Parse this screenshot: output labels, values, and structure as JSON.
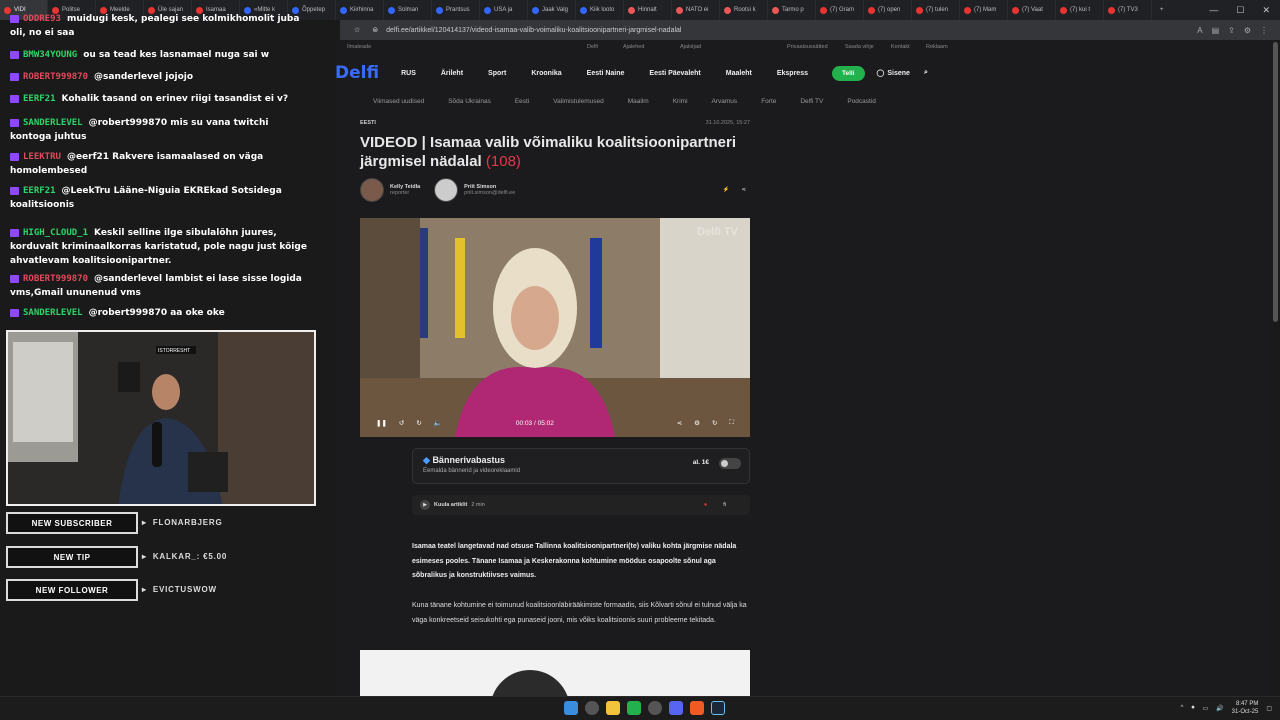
{
  "browser": {
    "tabs": [
      {
        "label": "VIDI",
        "color": "#e33"
      },
      {
        "label": "Politse",
        "color": "#e33"
      },
      {
        "label": "Meelde",
        "color": "#e33"
      },
      {
        "label": "Üle sajan",
        "color": "#e33"
      },
      {
        "label": "Isamaa",
        "color": "#e33"
      },
      {
        "label": "«Mitte k",
        "color": "#36f"
      },
      {
        "label": "Õppetep",
        "color": "#36f"
      },
      {
        "label": "Kiirhinna",
        "color": "#36f"
      },
      {
        "label": "Solman",
        "color": "#36f"
      },
      {
        "label": "Prantsus",
        "color": "#36f"
      },
      {
        "label": "USA ja",
        "color": "#36f"
      },
      {
        "label": "Jaak Valg",
        "color": "#36f"
      },
      {
        "label": "Kiik looto",
        "color": "#36f"
      },
      {
        "label": "Hinnalt",
        "color": "#e55"
      },
      {
        "label": "NATO ei",
        "color": "#e55"
      },
      {
        "label": "Rootsi k",
        "color": "#e55"
      },
      {
        "label": "Tarmo p",
        "color": "#e55"
      },
      {
        "label": "(7) Gram",
        "color": "#e33"
      },
      {
        "label": "(7) open",
        "color": "#e33"
      },
      {
        "label": "(7) tulen",
        "color": "#e33"
      },
      {
        "label": "(7) Mam",
        "color": "#e33"
      },
      {
        "label": "(7) Vaat",
        "color": "#e33"
      },
      {
        "label": "(7) kui t",
        "color": "#e33"
      },
      {
        "label": "(7) TV3",
        "color": "#e33"
      }
    ],
    "url": "delfi.ee/artikkel/120414137/videod-isamaa-valib-voimaliku-koalitsioonipartneri-jargmisel-nadalal",
    "win_controls": [
      "—",
      "☐",
      "✕"
    ]
  },
  "chat": {
    "messages": [
      {
        "name": "ODDRE93",
        "text": "muidugi kesk, pealegi see kolmikhomolit juba oli, no ei saa",
        "color": "red"
      },
      {
        "name": "BMW34YOUNG",
        "text": "ou sa tead kes lasnamael nuga sai w",
        "color": "grn"
      },
      {
        "name": "ROBERT999870",
        "text": "@sanderlevel jojojo",
        "color": "red"
      },
      {
        "name": "EERF21",
        "text": "Kohalik tasand on erinev riigi tasandist ei v?",
        "color": "grn"
      },
      {
        "name": "SANDERLEVEL",
        "text": "@robert999870 mis su vana twitchi kontoga juhtus",
        "color": "grn"
      },
      {
        "name": "LEEKTRU",
        "text": "@eerf21 Rakvere isamaalased on väga homolembesed",
        "color": "red"
      },
      {
        "name": "EERF21",
        "text": "@LeekTru Lääne-Niguia EKREkad Sotsidega koalitsioonis",
        "color": "grn"
      },
      {
        "name": "HIGH_CLOUD_1",
        "text": "Keskil selline ilge sibulalõhn juures, korduvalt kriminaalkorras karistatud, pole nagu just kõige ahvatlevam koalitsioonipartner.",
        "color": "grn"
      },
      {
        "name": "ROBERT999870",
        "text": "@sanderlevel lambist ei lase sisse logida vms,Gmail ununenud vms",
        "color": "red"
      },
      {
        "name": "SANDERLEVEL",
        "text": "@robert999870 aa oke oke",
        "color": "grn"
      }
    ]
  },
  "alerts": [
    {
      "label": "NEW SUBSCRIBER",
      "value": "FLONARBJERG"
    },
    {
      "label": "NEW TIP",
      "value": "KALKAR_: €5.00"
    },
    {
      "label": "NEW FOLLOWER",
      "value": "EVICTUSWOW"
    }
  ],
  "site": {
    "topline": [
      "Ilmateade",
      "Delfi",
      "Ajalehed",
      "Ajakirjad",
      "Privaatsussätted",
      "Saada vihje",
      "Kontakt",
      "Reklaam"
    ],
    "logo": "Delfi",
    "nav": [
      "RUS",
      "Ärileht",
      "Sport",
      "Kroonika",
      "Eesti Naine",
      "Eesti Päevaleht",
      "Maaleht",
      "Ekspress"
    ],
    "telli": "Telli",
    "sisene": "Sisene",
    "subnav": [
      "Viimased uudised",
      "Sõda Ukrainas",
      "Eesti",
      "Valimistulemused",
      "Maailm",
      "Krimi",
      "Arvamus",
      "Forte",
      "Delfi TV",
      "Podcastid"
    ]
  },
  "article": {
    "section": "EESTI",
    "date": "31.10.2025, 15:27",
    "title": "VIDEOD | Isamaa valib võimaliku koalitsioonipartneri järgmisel nädalal",
    "comment_count": "(108)",
    "author1_name": "Kelly Teidla",
    "author1_role": "reporter",
    "author2_name": "Priit Simson",
    "author2_role": "priit.simson@delfi.ee",
    "video_watermark": "Delfi TV",
    "video_time": "00:03  /  05:02",
    "banner_title": "Bännerivabastus",
    "banner_sub": "Eemalda bännerid ja videoreklaamid",
    "banner_price": "al. 1€",
    "listen_label": "Kuula artiklit",
    "listen_dur": "2 min",
    "lang": "fi",
    "lead": "Isamaa teatel langetavad nad otsuse Tallinna koalitsioonipartneri(te) valiku kohta järgmise nädala esimeses pooles. Tänane Isamaa ja Keskerakonna kohtumine möödus osapoolte sõnul aga sõbralikus ja konstruktiivses vaimus.",
    "body": "Kuna tänane kohtumine ei toimunud koalitsioonläbirääkimiste formaadis, siis Kõlvarti sõnul ei tulnud välja ka väga konkreetseid seisukohti ega punaseid jooni, mis võiks koalitsioonis suuri probleeme tekitada."
  },
  "taskbar": {
    "time": "8:47 PM",
    "date": "31-Oct-25"
  }
}
